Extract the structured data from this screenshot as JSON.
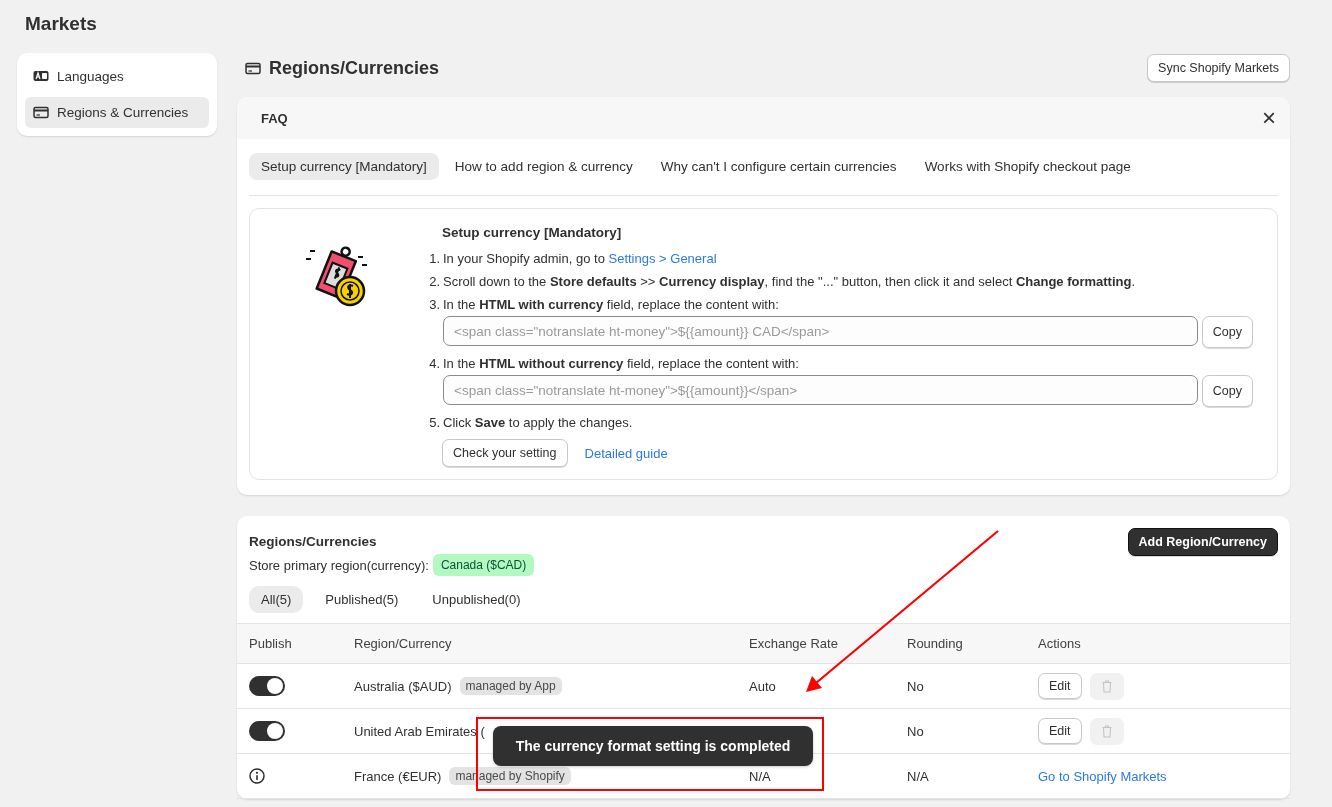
{
  "page_title": "Markets",
  "sidebar": {
    "items": [
      {
        "label": "Languages",
        "selected": false
      },
      {
        "label": "Regions & Currencies",
        "selected": true
      }
    ]
  },
  "header": {
    "title": "Regions/Currencies",
    "button": "Sync Shopify Markets"
  },
  "faq": {
    "title": "FAQ",
    "close": "×",
    "tabs": [
      {
        "label": "Setup currency [Mandatory]",
        "selected": true
      },
      {
        "label": "How to add region & currency",
        "selected": false
      },
      {
        "label": "Why can't I configure certain currencies",
        "selected": false
      },
      {
        "label": "Works with Shopify checkout page",
        "selected": false
      }
    ],
    "heading": "Setup currency [Mandatory]",
    "steps": [
      {
        "number": "1.",
        "text": "In your Shopify admin, go to ",
        "link": "Settings > General"
      },
      {
        "number": "2.",
        "text": "Scroll down to the **Store defaults** >> **Currency display**, find the \"...\" button, then click it and select **Change formatting**."
      },
      {
        "number": "3.",
        "text": "In the **HTML with currency** field, replace the content with:",
        "placeholder": "<span class=\"notranslate ht-money\">${{amount}} CAD</span>",
        "copy": "Copy"
      },
      {
        "number": "4.",
        "text": "In the **HTML without currency** field, replace the content with:",
        "placeholder": "<span class=\"notranslate ht-money\">${{amount}}</span>",
        "copy": "Copy"
      },
      {
        "number": "5.",
        "text": "Click **Save** to apply the changes."
      }
    ],
    "check_button": "Check your setting",
    "guide_link": "Detailed guide"
  },
  "regions": {
    "title": "Regions/Currencies",
    "add_button": "Add Region/Currency",
    "primary_label": "Store primary region(currency):",
    "primary_value": "Canada ($CAD)",
    "filters": [
      {
        "label": "All(5)",
        "selected": true
      },
      {
        "label": "Published(5)",
        "selected": false
      },
      {
        "label": "Unpublished(0)",
        "selected": false
      }
    ],
    "columns": [
      "Publish",
      "Region/Currency",
      "Exchange Rate",
      "Rounding",
      "Actions"
    ],
    "rows": [
      {
        "kind": "toggle",
        "on": true,
        "region": "Australia ($AUD)",
        "badge": "managed by App",
        "exchange": "Auto",
        "rounding": "No",
        "edit": "Edit",
        "delete_disabled": true
      },
      {
        "kind": "toggle",
        "on": true,
        "region": "United Arab Emirates (",
        "rounding": "No",
        "edit": "Edit",
        "delete_disabled": true
      },
      {
        "kind": "info",
        "region": "France (€EUR)",
        "badge": "managed by Shopify",
        "exchange": "N/A",
        "rounding": "N/A",
        "link": "Go to Shopify Markets"
      }
    ]
  },
  "toast": "The currency format setting is completed",
  "annotation_arrow": true,
  "highlight_box": true
}
